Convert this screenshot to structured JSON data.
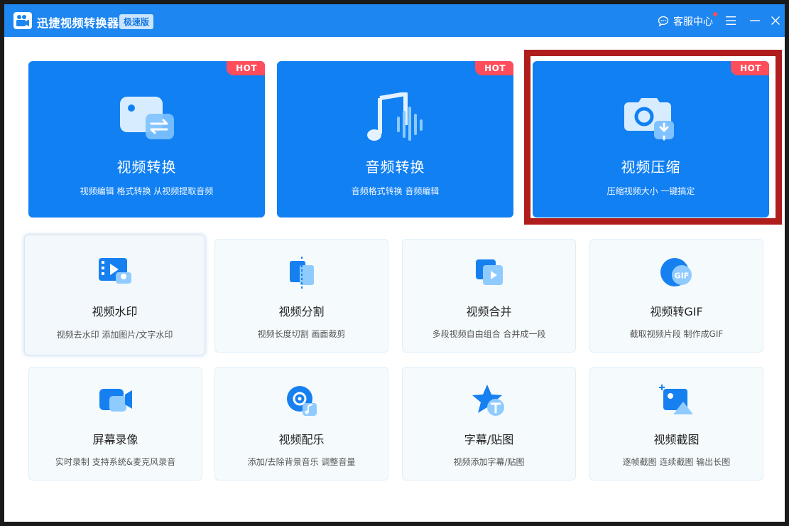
{
  "titlebar": {
    "app_title": "迅捷视频转换器",
    "edition": "极速版",
    "service_label": "客服中心",
    "logo_icon": "camera-logo-icon",
    "menu_icon": "hamburger-menu-icon",
    "minimize_icon": "minimize-icon",
    "close_icon": "close-icon"
  },
  "colors": {
    "titlebar": "#1e86f0",
    "card_blue": "#1180f3",
    "hot_badge": "#ff4d5b",
    "highlight": "#b01d1d"
  },
  "feature_cards": [
    {
      "title": "视频转换",
      "subtitle": "视频编辑 格式转换 从视频提取音频",
      "badge": "HOT",
      "icon": "video-convert-icon"
    },
    {
      "title": "音频转换",
      "subtitle": "音频格式转换 音频编辑",
      "badge": "HOT",
      "icon": "audio-convert-icon"
    },
    {
      "title": "视频压缩",
      "subtitle": "压缩视频大小 一键搞定",
      "badge": "HOT",
      "icon": "video-compress-icon"
    }
  ],
  "tools": [
    {
      "title": "视频水印",
      "subtitle": "视频去水印 添加图片/文字水印",
      "icon": "video-watermark-icon"
    },
    {
      "title": "视频分割",
      "subtitle": "视频长度切割 画面裁剪",
      "icon": "video-split-icon"
    },
    {
      "title": "视频合并",
      "subtitle": "多段视频自由组合 合并成一段",
      "icon": "video-merge-icon"
    },
    {
      "title": "视频转GIF",
      "subtitle": "截取视频片段 制作成GIF",
      "icon": "video-to-gif-icon"
    },
    {
      "title": "屏幕录像",
      "subtitle": "实时录制 支持系统&麦克风录音",
      "icon": "screen-record-icon"
    },
    {
      "title": "视频配乐",
      "subtitle": "添加/去除背景音乐 调整音量",
      "icon": "video-music-icon"
    },
    {
      "title": "字幕/贴图",
      "subtitle": "视频添加字幕/贴图",
      "icon": "subtitle-sticker-icon"
    },
    {
      "title": "视频截图",
      "subtitle": "逐帧截图 连续截图 输出长图",
      "icon": "video-screenshot-icon"
    }
  ],
  "gif_label": "GIF"
}
